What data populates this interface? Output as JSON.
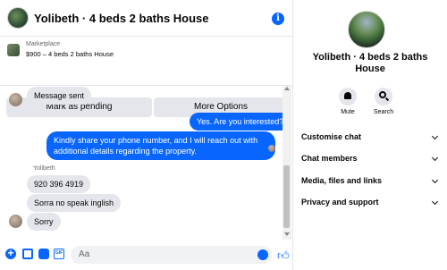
{
  "header": {
    "title": "Yolibeth · 4 beds 2 baths House"
  },
  "listing": {
    "kind": "Marketplace",
    "description": "$900 – 4 beds 2 baths House"
  },
  "buttons": {
    "mark_pending": "Mark as pending",
    "more_options": "More Options"
  },
  "messages": [
    {
      "side": "in",
      "text": "Message sent"
    },
    {
      "side": "out",
      "text": "Yes. Are you interested?"
    },
    {
      "side": "out",
      "text": "Kindly share your phone number, and I will reach out with additional details regarding the property."
    },
    {
      "side": "in",
      "sender": "Yolibeth",
      "text": "920 396 4919"
    },
    {
      "side": "in",
      "text": "Sorra no speak inglish"
    },
    {
      "side": "in",
      "text": "Sorry"
    }
  ],
  "composer": {
    "placeholder": "Aa"
  },
  "info_panel": {
    "title": "Yolibeth · 4 beds 2 baths House",
    "actions": [
      {
        "label": "Mute",
        "icon": "bell-icon"
      },
      {
        "label": "Search",
        "icon": "search-icon"
      }
    ],
    "sections": [
      "Customise chat",
      "Chat members",
      "Media, files and links",
      "Privacy and support"
    ]
  },
  "colors": {
    "accent": "#0866ff",
    "bubble_in": "#e4e6eb",
    "text_secondary": "#65676b"
  }
}
